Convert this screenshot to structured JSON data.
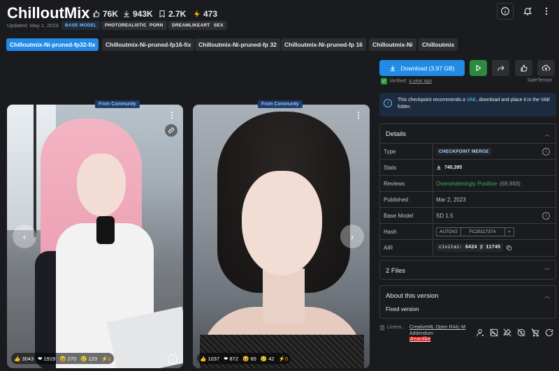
{
  "model": {
    "title": "ChilloutMix",
    "stats": {
      "likes": "76K",
      "downloads": "943K",
      "bookmarks": "2.7K",
      "buzz": "473"
    },
    "updated": "Updated: May 1, 2023",
    "tags": [
      "BASE MODEL",
      "PHOTOREALISTIC",
      "PORN",
      "DREAMLIKEART",
      "SEX"
    ]
  },
  "header_icons": [
    "info-icon",
    "bell-plus-icon",
    "more-dots-icon"
  ],
  "versions": [
    "Chilloutmix-Ni-pruned-fp32-fix",
    "Chilloutmix-Ni-pruned-fp16-fix",
    "Chilloutmix-Ni-pruned-fp 32",
    "Chilloutmix-Ni-pruned-fp 16",
    "Chilloutmix-Ni",
    "Chilloutmix"
  ],
  "active_version": 0,
  "gallery": [
    {
      "badge": "From Community",
      "reactions": {
        "likes": "3043",
        "hearts": "1919",
        "laughs": "270",
        "cries": "123",
        "buzz": "0"
      }
    },
    {
      "badge": "From Community",
      "reactions": {
        "likes": "1037",
        "hearts": "872",
        "laughs": "65",
        "cries": "42",
        "buzz": "0"
      }
    }
  ],
  "download": {
    "label": "Download (3.97 GB)",
    "verified_label": "Verified:",
    "verified_when": "a year ago",
    "format": "SafeTensor"
  },
  "notice": {
    "prefix": "This checkpoint recommends a",
    "link": "VAE",
    "suffix": ", download and place it in the VAE folder."
  },
  "details": {
    "title": "Details",
    "rows": {
      "type": {
        "key": "Type",
        "value": "CHECKPOINT MERGE"
      },
      "stats": {
        "key": "Stats",
        "value": "740,395"
      },
      "reviews": {
        "key": "Reviews",
        "value": "Overwhelmingly Positive",
        "count": "(69,868)"
      },
      "published": {
        "key": "Published",
        "value": "Mar 2, 2023"
      },
      "base_model": {
        "key": "Base Model",
        "value": "SD 1.5"
      },
      "hash": {
        "key": "Hash",
        "algo": "AUTOV2",
        "value": "FC2511737A",
        "arrow": ">"
      },
      "air": {
        "key": "AIR",
        "prefix": "civitai:",
        "model_id": "6424",
        "at": "@",
        "version_id": "11745"
      }
    }
  },
  "files": {
    "title": "2 Files"
  },
  "about": {
    "title": "About this version",
    "body": "Fixed version"
  },
  "license": {
    "label": "Licens...",
    "links": [
      "CreativeML Open RAIL-M",
      "Addendum",
      "dreamlike"
    ]
  },
  "license_icons": [
    "user-icon",
    "image-off-icon",
    "brush-off-icon",
    "coin-off-icon",
    "shopping-cart-off-icon",
    "rotate-icon"
  ]
}
